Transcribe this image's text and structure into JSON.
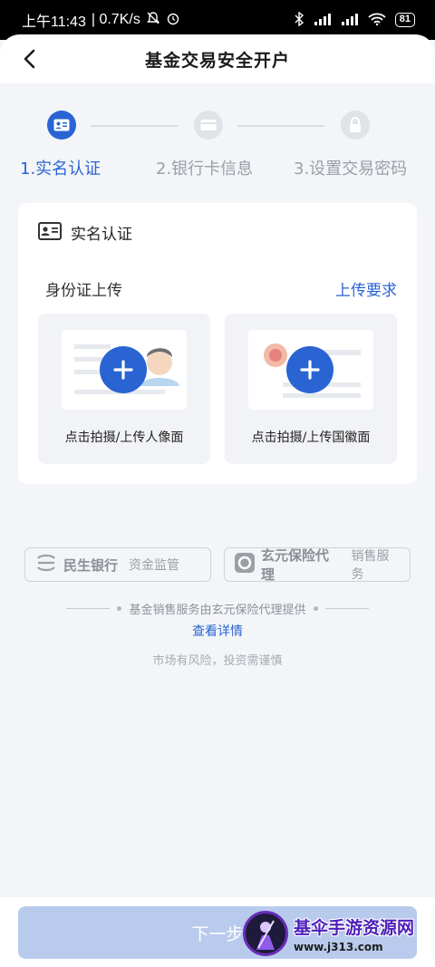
{
  "status_bar": {
    "time": "上午11:43",
    "speed": "| 0.7K/s",
    "battery": "81"
  },
  "header": {
    "title": "基金交易安全开户"
  },
  "steps": [
    {
      "label": "1.实名认证",
      "state": "active",
      "icon": "id-card-icon"
    },
    {
      "label": "2.银行卡信息",
      "state": "inactive",
      "icon": "bank-card-icon"
    },
    {
      "label": "3.设置交易密码",
      "state": "inactive",
      "icon": "lock-icon"
    }
  ],
  "card": {
    "section_title": "实名认证",
    "upload_title": "身份证上传",
    "upload_requirements": "上传要求",
    "front_caption": "点击拍摄/上传人像面",
    "back_caption": "点击拍摄/上传国徽面"
  },
  "partners": [
    {
      "name": "民生银行",
      "sub": "资金监管"
    },
    {
      "name": "玄元保险代理",
      "sub": "销售服务"
    }
  ],
  "provider_note": "基金销售服务由玄元保险代理提供",
  "details_link": "查看详情",
  "risk_note": "市场有风险，投资需谨慎",
  "next_button": "下一步",
  "watermark": {
    "title": "基伞手游资源网",
    "url": "www.j313.com"
  },
  "colors": {
    "accent": "#2a64d3",
    "button_disabled": "#b9cbed",
    "background": "#f3f5f8"
  }
}
